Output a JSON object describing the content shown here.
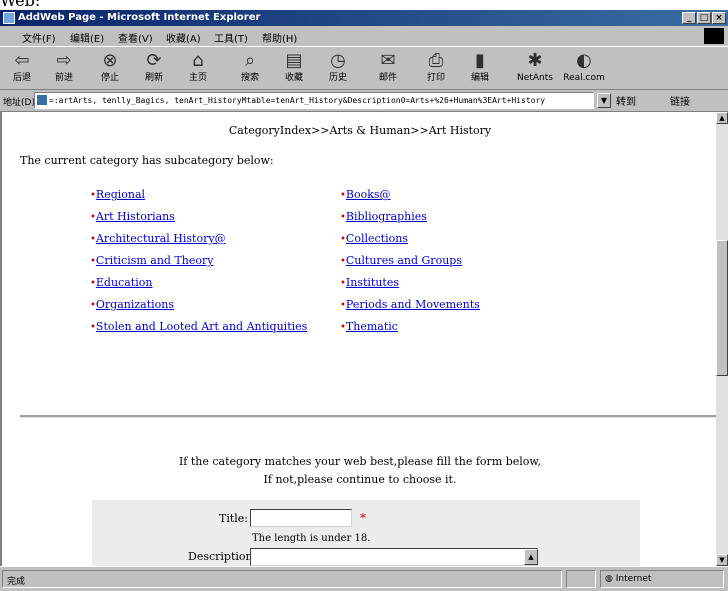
{
  "top_clip": "Web:",
  "window": {
    "title": "AddWeb Page - Microsoft Internet Explorer",
    "min_label": "_",
    "max_label": "□",
    "close_label": "×"
  },
  "menu": {
    "items": [
      "文件(F)",
      "编辑(E)",
      "查看(V)",
      "收藏(A)",
      "工具(T)",
      "帮助(H)"
    ]
  },
  "toolbar": {
    "buttons": [
      {
        "label": "后退",
        "icon": "back-arrow-icon",
        "glyph": "⇦"
      },
      {
        "label": "前进",
        "icon": "forward-arrow-icon",
        "glyph": "⇨"
      },
      {
        "label": "停止",
        "icon": "stop-icon",
        "glyph": "⊗"
      },
      {
        "label": "刷新",
        "icon": "refresh-icon",
        "glyph": "⟳"
      },
      {
        "label": "主页",
        "icon": "home-icon",
        "glyph": "⌂"
      },
      {
        "label": "搜索",
        "icon": "search-icon",
        "glyph": "⌕"
      },
      {
        "label": "收藏",
        "icon": "favorites-icon",
        "glyph": "▤"
      },
      {
        "label": "历史",
        "icon": "history-icon",
        "glyph": "◷"
      },
      {
        "label": "邮件",
        "icon": "mail-icon",
        "glyph": "✉"
      },
      {
        "label": "打印",
        "icon": "print-icon",
        "glyph": "⎙"
      },
      {
        "label": "编辑",
        "icon": "edit-icon",
        "glyph": "▮"
      },
      {
        "label": "NetAnts",
        "icon": "netants-icon",
        "glyph": "✱"
      },
      {
        "label": "Real.com",
        "icon": "realcom-icon",
        "glyph": "◐"
      }
    ]
  },
  "address": {
    "label": "地址(D)",
    "value": "=:artArts, tenlly_Bagics, tenArt_HistoryMtable=tenArt_History&Description0=Arts+%26+Human%3EArt+History",
    "go_label": "转到",
    "links_label": "链接"
  },
  "content": {
    "breadcrumb": "CategoryIndex>>Arts & Human>>Art History",
    "intro": "The current category has subcategory below:",
    "bullet": "•",
    "left_links": [
      "Regional",
      "Art Historians",
      "Architectural History@",
      "Criticism and Theory",
      "Education",
      "Organizations",
      "Stolen and Looted Art and Antiquities"
    ],
    "right_links": [
      "Books@",
      "Bibliographies",
      "Collections",
      "Cultures and Groups",
      "Institutes",
      "Periods and Movements",
      "Thematic"
    ],
    "prompt_line1": "If the category matches your web best,please fill the form below,",
    "prompt_line2": "If not,please continue to choose it.",
    "form": {
      "title_label": "Title:",
      "title_value": "",
      "required_mark": "*",
      "title_hint": "The length is under 18.",
      "description_label": "Description:",
      "description_value": ""
    }
  },
  "status": {
    "left": "完成",
    "zone": "Internet"
  },
  "colors": {
    "link": "#0000cc",
    "bullet": "#cc0000",
    "titlebar": "#0a246a"
  }
}
